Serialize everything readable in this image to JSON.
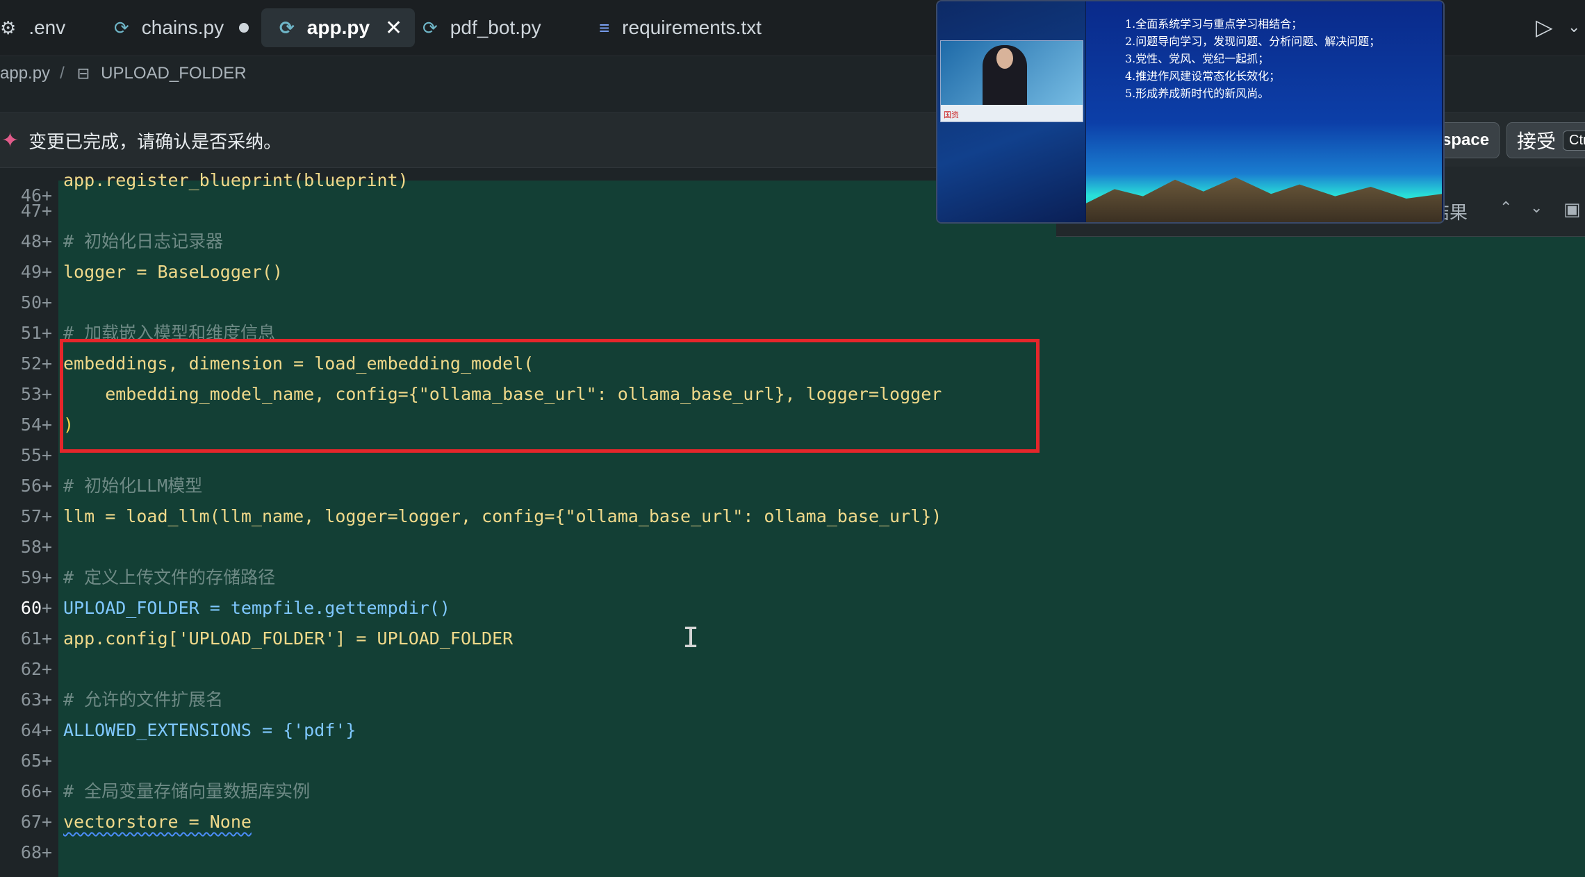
{
  "tabs": [
    {
      "label": ".env",
      "icon": "gear-icon"
    },
    {
      "label": "chains.py",
      "icon": "python-icon",
      "modified": true
    },
    {
      "label": "app.py",
      "icon": "python-icon",
      "active": true
    },
    {
      "label": "pdf_bot.py",
      "icon": "python-icon"
    },
    {
      "label": "requirements.txt",
      "icon": "text-lines-icon"
    }
  ],
  "breadcrumb": {
    "file": "app.py",
    "separator": "/",
    "symbol": "UPLOAD_FOLDER"
  },
  "banner": {
    "message": "变更已完成，请确认是否采纳。",
    "reject_label": "tspace",
    "accept_label": "接受",
    "accept_kbd": "Ctr"
  },
  "find": {
    "results_label": "结果"
  },
  "video": {
    "lines": [
      "1.全面系统学习与重点学习相结合；",
      "2.问题导向学习，发现问题、分析问题、解决问题；",
      "3.党性、党风、党纪一起抓；",
      "4.推进作风建设常态化长效化；",
      "5.形成养成新时代的新风尚。"
    ],
    "logo": "国资"
  },
  "editor": {
    "lines": [
      {
        "n": "46",
        "text": "app.register_blueprint(blueprint)"
      },
      {
        "n": "47",
        "text": ""
      },
      {
        "n": "48",
        "text": "# 初始化日志记录器"
      },
      {
        "n": "49",
        "text": "logger = BaseLogger()"
      },
      {
        "n": "50",
        "text": ""
      },
      {
        "n": "51",
        "text": "# 加载嵌入模型和维度信息"
      },
      {
        "n": "52",
        "text": "embeddings, dimension = load_embedding_model("
      },
      {
        "n": "53",
        "text": "    embedding_model_name, config={\"ollama_base_url\": ollama_base_url}, logger=logger"
      },
      {
        "n": "54",
        "text": ")"
      },
      {
        "n": "55",
        "text": ""
      },
      {
        "n": "56",
        "text": "# 初始化LLM模型"
      },
      {
        "n": "57",
        "text": "llm = load_llm(llm_name, logger=logger, config={\"ollama_base_url\": ollama_base_url})"
      },
      {
        "n": "58",
        "text": ""
      },
      {
        "n": "59",
        "text": "# 定义上传文件的存储路径"
      },
      {
        "n": "60",
        "text": "UPLOAD_FOLDER = tempfile.gettempdir()"
      },
      {
        "n": "61",
        "text": "app.config['UPLOAD_FOLDER'] = UPLOAD_FOLDER"
      },
      {
        "n": "62",
        "text": ""
      },
      {
        "n": "63",
        "text": "# 允许的文件扩展名"
      },
      {
        "n": "64",
        "text": "ALLOWED_EXTENSIONS = {'pdf'}"
      },
      {
        "n": "65",
        "text": ""
      },
      {
        "n": "66",
        "text": "# 全局变量存储向量数据库实例"
      },
      {
        "n": "67",
        "text": "vectorstore = None"
      },
      {
        "n": "68",
        "text": ""
      }
    ],
    "current_line": "60",
    "diff_marker": "+"
  }
}
